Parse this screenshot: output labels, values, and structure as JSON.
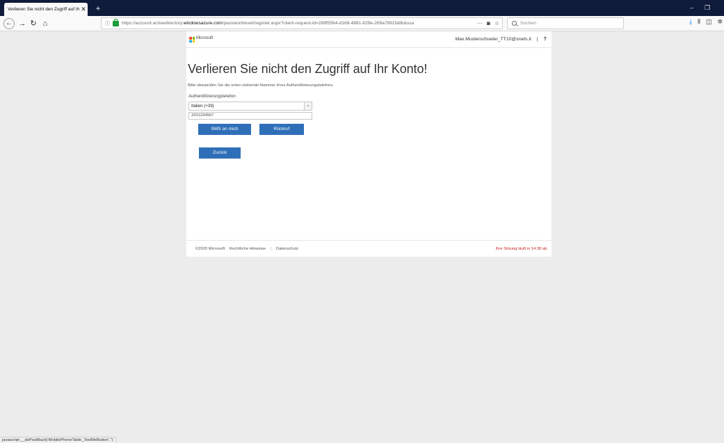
{
  "browser": {
    "tab_title": "Verlieren Sie nicht den Zugriff auf Ihr",
    "tab_close": "✕",
    "new_tab": "+",
    "url_prefix": "https://account.activedirectory.",
    "url_domain": "windowsazure.com",
    "url_rest": "/passwordreset/register.aspx?client-request-id=288f5564-d168-4881-829e-269a7891fa9b&ssa",
    "search_placeholder": "Suchen",
    "window_controls": {
      "minimize": "–",
      "maximize": "❐"
    },
    "status_text": "javascript:__doPostBack('MobilePhoneTable_TextMeButton','')"
  },
  "brand": {
    "name": "Microsoft",
    "logo_colors": [
      "#f25022",
      "#7fba00",
      "#00a4ef",
      "#ffb900"
    ]
  },
  "account": {
    "email": "Max.Musterschueler_TT10@snets.it",
    "separator": "|",
    "help": "?"
  },
  "main": {
    "heading": "Verlieren Sie nicht den Zugriff auf Ihr Konto!",
    "hint": "Bitte überprüfen Sie die unten stehende Nummer Ihres Authentifizierungstelefons.",
    "phone_label": "Authentifizierungstelefon",
    "country_value": "Italien (+39)",
    "phone_value": "3331234567",
    "sms_button": "SMS an mich",
    "callback_button": "Rückruf",
    "back_button": "Zurück"
  },
  "footer": {
    "copyright": "©2020 Microsoft",
    "legal": "Rechtliche Hinweise",
    "separator": "|",
    "privacy": "Datenschutz",
    "session": "Ihre Sitzung läuft in 14:38 ab."
  },
  "colors": {
    "accent_button": "#2f6fb8",
    "tabbar_bg": "#0f1b3b",
    "session_text": "#c62323"
  }
}
